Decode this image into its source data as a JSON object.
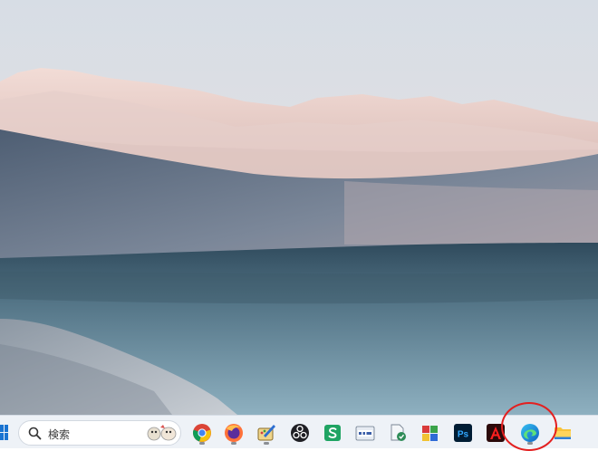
{
  "desktop": {
    "wallpaper": "desert-lake-landscape"
  },
  "taskbar": {
    "start_icon": "windows-logo-icon",
    "search": {
      "icon": "search-icon",
      "label": "検索"
    },
    "apps": [
      {
        "name": "chrome",
        "icon": "chrome-icon",
        "running": true
      },
      {
        "name": "firefox",
        "icon": "firefox-icon",
        "running": true
      },
      {
        "name": "paint",
        "icon": "paint-brush-icon",
        "running": true
      },
      {
        "name": "obs",
        "icon": "obs-icon",
        "running": false
      },
      {
        "name": "wps-sheet",
        "icon": "spreadsheet-s-icon",
        "running": false
      },
      {
        "name": "qrc",
        "icon": "qrc-icon",
        "running": false
      },
      {
        "name": "file-tool",
        "icon": "file-tool-icon",
        "running": false
      },
      {
        "name": "colorful-app",
        "icon": "colorful-app-icon",
        "running": false
      },
      {
        "name": "photoshop",
        "icon": "photoshop-icon",
        "label": "Ps",
        "running": false
      },
      {
        "name": "acrobat",
        "icon": "acrobat-icon",
        "running": false
      },
      {
        "name": "edge",
        "icon": "edge-icon",
        "running": true
      },
      {
        "name": "file-explorer",
        "icon": "folder-icon",
        "running": false
      }
    ],
    "highlight_color": "#e32020"
  }
}
